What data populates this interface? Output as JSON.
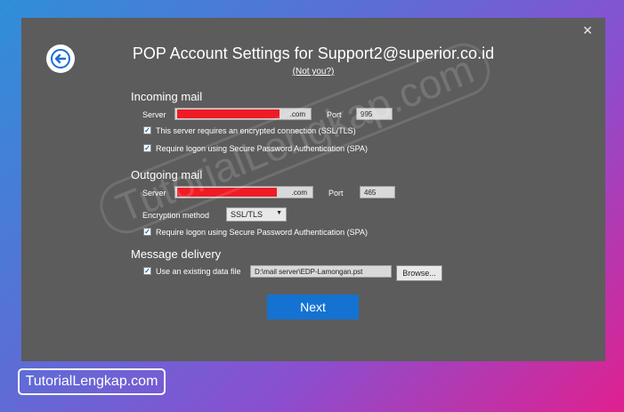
{
  "dialog": {
    "close_glyph": "✕",
    "title": "POP Account Settings for Support2@superior.co.id",
    "not_you": "(Not you?)"
  },
  "incoming": {
    "heading": "Incoming mail",
    "server_label": "Server",
    "server_suffix": ".com",
    "port_label": "Port",
    "port_value": "995",
    "ssl_label": "This server requires an encrypted connection (SSL/TLS)",
    "spa_label": "Require logon using Secure Password Authentication (SPA)"
  },
  "outgoing": {
    "heading": "Outgoing mail",
    "server_label": "Server",
    "server_suffix": ".com",
    "port_label": "Port",
    "port_value": "465",
    "encryption_label": "Encryption method",
    "encryption_value": "SSL/TLS",
    "spa_label": "Require logon using Secure Password Authentication (SPA)"
  },
  "delivery": {
    "heading": "Message delivery",
    "existing_label": "Use an existing data file",
    "file_path": "D:\\mail server\\EDP-Lamongan.pst",
    "browse_label": "Browse..."
  },
  "next_label": "Next",
  "watermark": "TutorialLengkap.com",
  "badge": "TutorialLengkap.com",
  "colors": {
    "dialog_bg": "#5c5c5c",
    "accent": "#1473d2",
    "redaction": "#ee1c25"
  },
  "icons": {
    "back": "arrow-left-icon",
    "close": "close-icon",
    "check": "checkmark-icon",
    "dropdown": "chevron-down-icon"
  }
}
